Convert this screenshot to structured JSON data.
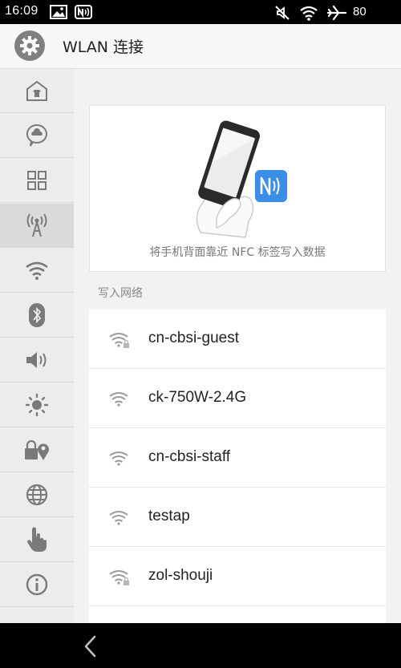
{
  "status_bar": {
    "time": "16:09",
    "battery": "80"
  },
  "header": {
    "title": "WLAN 连接"
  },
  "sidebar": {
    "items": [
      {
        "icon": "home-icon"
      },
      {
        "icon": "cloud-chat-icon"
      },
      {
        "icon": "apps-grid-icon"
      },
      {
        "icon": "hotspot-antenna-icon",
        "active": true
      },
      {
        "icon": "wifi-icon"
      },
      {
        "icon": "bluetooth-icon"
      },
      {
        "icon": "volume-icon"
      },
      {
        "icon": "brightness-icon"
      },
      {
        "icon": "lock-location-icon"
      },
      {
        "icon": "globe-icon"
      },
      {
        "icon": "hand-pointer-icon"
      },
      {
        "icon": "info-icon"
      }
    ]
  },
  "nfc_card": {
    "caption": "将手机背面靠近 NFC 标签写入数据",
    "accent_color": "#3a8ee6"
  },
  "networks_section": {
    "label": "写入网络",
    "networks": [
      {
        "name": "cn-cbsi-guest",
        "secured": true
      },
      {
        "name": "ck-750W-2.4G",
        "secured": false
      },
      {
        "name": "cn-cbsi-staff",
        "secured": false
      },
      {
        "name": "testap",
        "secured": false
      },
      {
        "name": "zol-shouji",
        "secured": true
      }
    ]
  }
}
